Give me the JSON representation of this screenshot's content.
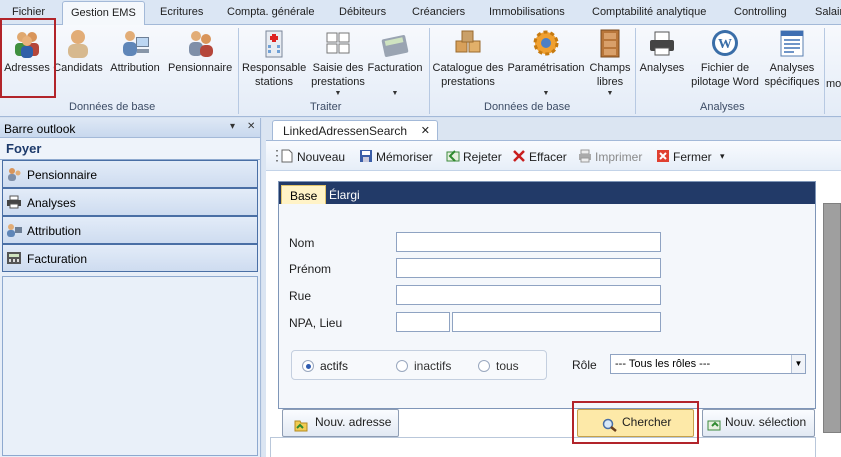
{
  "ribbon_tabs": [
    "Fichier",
    "Gestion EMS",
    "Ecritures",
    "Compta. générale",
    "Débiteurs",
    "Créanciers",
    "Immobilisations",
    "Comptabilité analytique",
    "Controlling",
    "Salair"
  ],
  "active_tab": "Gestion EMS",
  "ribbon": {
    "buttons": [
      {
        "label": "Adresses",
        "icon": "people-icon"
      },
      {
        "label": "Candidats",
        "icon": "person-icon"
      },
      {
        "label": "Attribution",
        "icon": "person-computer-icon"
      },
      {
        "label": "Pensionnaire",
        "icon": "resident-icon"
      },
      {
        "label": "Responsable stations",
        "line1": "Responsable",
        "line2": "stations",
        "icon": "building-icon"
      },
      {
        "label": "Saisie des prestations",
        "line1": "Saisie des",
        "line2": "prestations",
        "icon": "keyboard-icon"
      },
      {
        "label": "Facturation",
        "icon": "calculator-icon"
      },
      {
        "label": "Catalogue des prestations",
        "line1": "Catalogue des",
        "line2": "prestations",
        "icon": "boxes-icon"
      },
      {
        "label": "Paramétrisation",
        "icon": "gear-icon"
      },
      {
        "label": "Champs libres",
        "line1": "Champs",
        "line2": "libres",
        "icon": "cabinet-icon"
      },
      {
        "label": "Analyses",
        "icon": "printer-icon"
      },
      {
        "label": "Fichier de pilotage Word",
        "line1": "Fichier de",
        "line2": "pilotage Word",
        "icon": "word-icon"
      },
      {
        "label": "Analyses spécifiques",
        "line1": "Analyses",
        "line2": "spécifiques",
        "icon": "report-icon"
      },
      {
        "label": "mo",
        "icon": "more-icon"
      }
    ],
    "groups": [
      "Données de base",
      "Traiter",
      "Données de base",
      "Analyses"
    ]
  },
  "outlook": {
    "title": "Barre outlook",
    "controls": [
      "▾",
      "✕"
    ],
    "section": "Foyer",
    "items": [
      {
        "label": "Pensionnaire",
        "icon": "resident-icon"
      },
      {
        "label": "Analyses",
        "icon": "printer-icon"
      },
      {
        "label": "Attribution",
        "icon": "person-computer-icon"
      },
      {
        "label": "Facturation",
        "icon": "calculator-icon"
      }
    ]
  },
  "document": {
    "tab_title": "LinkedAdressenSearch",
    "tab_close": "✕",
    "toolbar": [
      {
        "label": "Nouveau",
        "icon": "new-document-icon",
        "enabled": true
      },
      {
        "label": "Mémoriser",
        "icon": "save-icon",
        "enabled": true
      },
      {
        "label": "Rejeter",
        "icon": "reject-icon",
        "enabled": true
      },
      {
        "label": "Effacer",
        "icon": "delete-icon",
        "enabled": true
      },
      {
        "label": "Imprimer",
        "icon": "print-icon",
        "enabled": false
      },
      {
        "label": "Fermer",
        "icon": "close-icon",
        "enabled": true
      }
    ],
    "subtabs": [
      "Base",
      "Élargi"
    ],
    "fields": [
      {
        "label": "Nom",
        "value": ""
      },
      {
        "label": "Prénom",
        "value": ""
      },
      {
        "label": "Rue",
        "value": ""
      },
      {
        "label": "NPA, Lieu",
        "value_npa": "",
        "value_lieu": ""
      }
    ],
    "status_options": [
      "actifs",
      "inactifs",
      "tous"
    ],
    "status_selected": "actifs",
    "role_label": "Rôle",
    "role_value": "--- Tous les rôles ---",
    "buttons": {
      "new_address": "Nouv. adresse",
      "search": "Chercher",
      "new_selection": "Nouv. sélection"
    }
  },
  "colors": {
    "highlight_border": "#b2242a",
    "subtab_bar": "#223a68",
    "active_subtab": "#fff3c7",
    "search_button": "#fde9a8"
  }
}
